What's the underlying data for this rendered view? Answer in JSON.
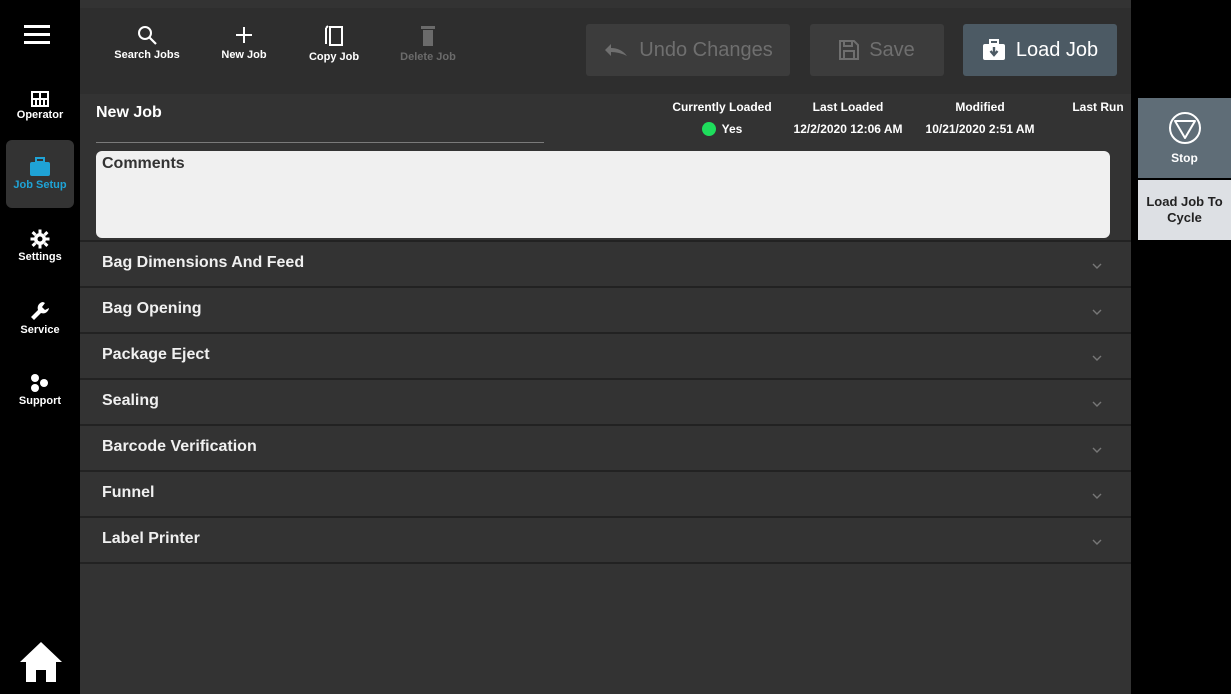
{
  "nav": {
    "items": [
      {
        "label": "Operator",
        "icon": "grid-icon"
      },
      {
        "label": "Job Setup",
        "icon": "briefcase-icon"
      },
      {
        "label": "Settings",
        "icon": "gear-icon"
      },
      {
        "label": "Service",
        "icon": "wrench-icon"
      },
      {
        "label": "Support",
        "icon": "support-icon"
      }
    ],
    "active": "Job Setup",
    "active_color": "#1fa3d6"
  },
  "toolbar": {
    "search_label": "Search Jobs",
    "new_label": "New Job",
    "copy_label": "Copy Job",
    "delete_label": "Delete Job",
    "undo_label": "Undo Changes",
    "save_label": "Save",
    "load_label": "Load Job"
  },
  "job": {
    "name": "New Job",
    "currently_loaded_label": "Currently Loaded",
    "currently_loaded_value": "Yes",
    "last_loaded_label": "Last Loaded",
    "last_loaded_value": "12/2/2020 12:06 AM",
    "modified_label": "Modified",
    "modified_value": "10/21/2020 2:51 AM",
    "last_run_label": "Last Run",
    "status_color": "#1edd5c"
  },
  "comments": {
    "label": "Comments"
  },
  "sections": [
    "Bag Dimensions And Feed",
    "Bag Opening",
    "Package Eject",
    "Sealing",
    "Barcode Verification",
    "Funnel",
    "Label Printer"
  ],
  "right": {
    "stop_label": "Stop",
    "load_cycle_label": "Load Job To Cycle"
  }
}
